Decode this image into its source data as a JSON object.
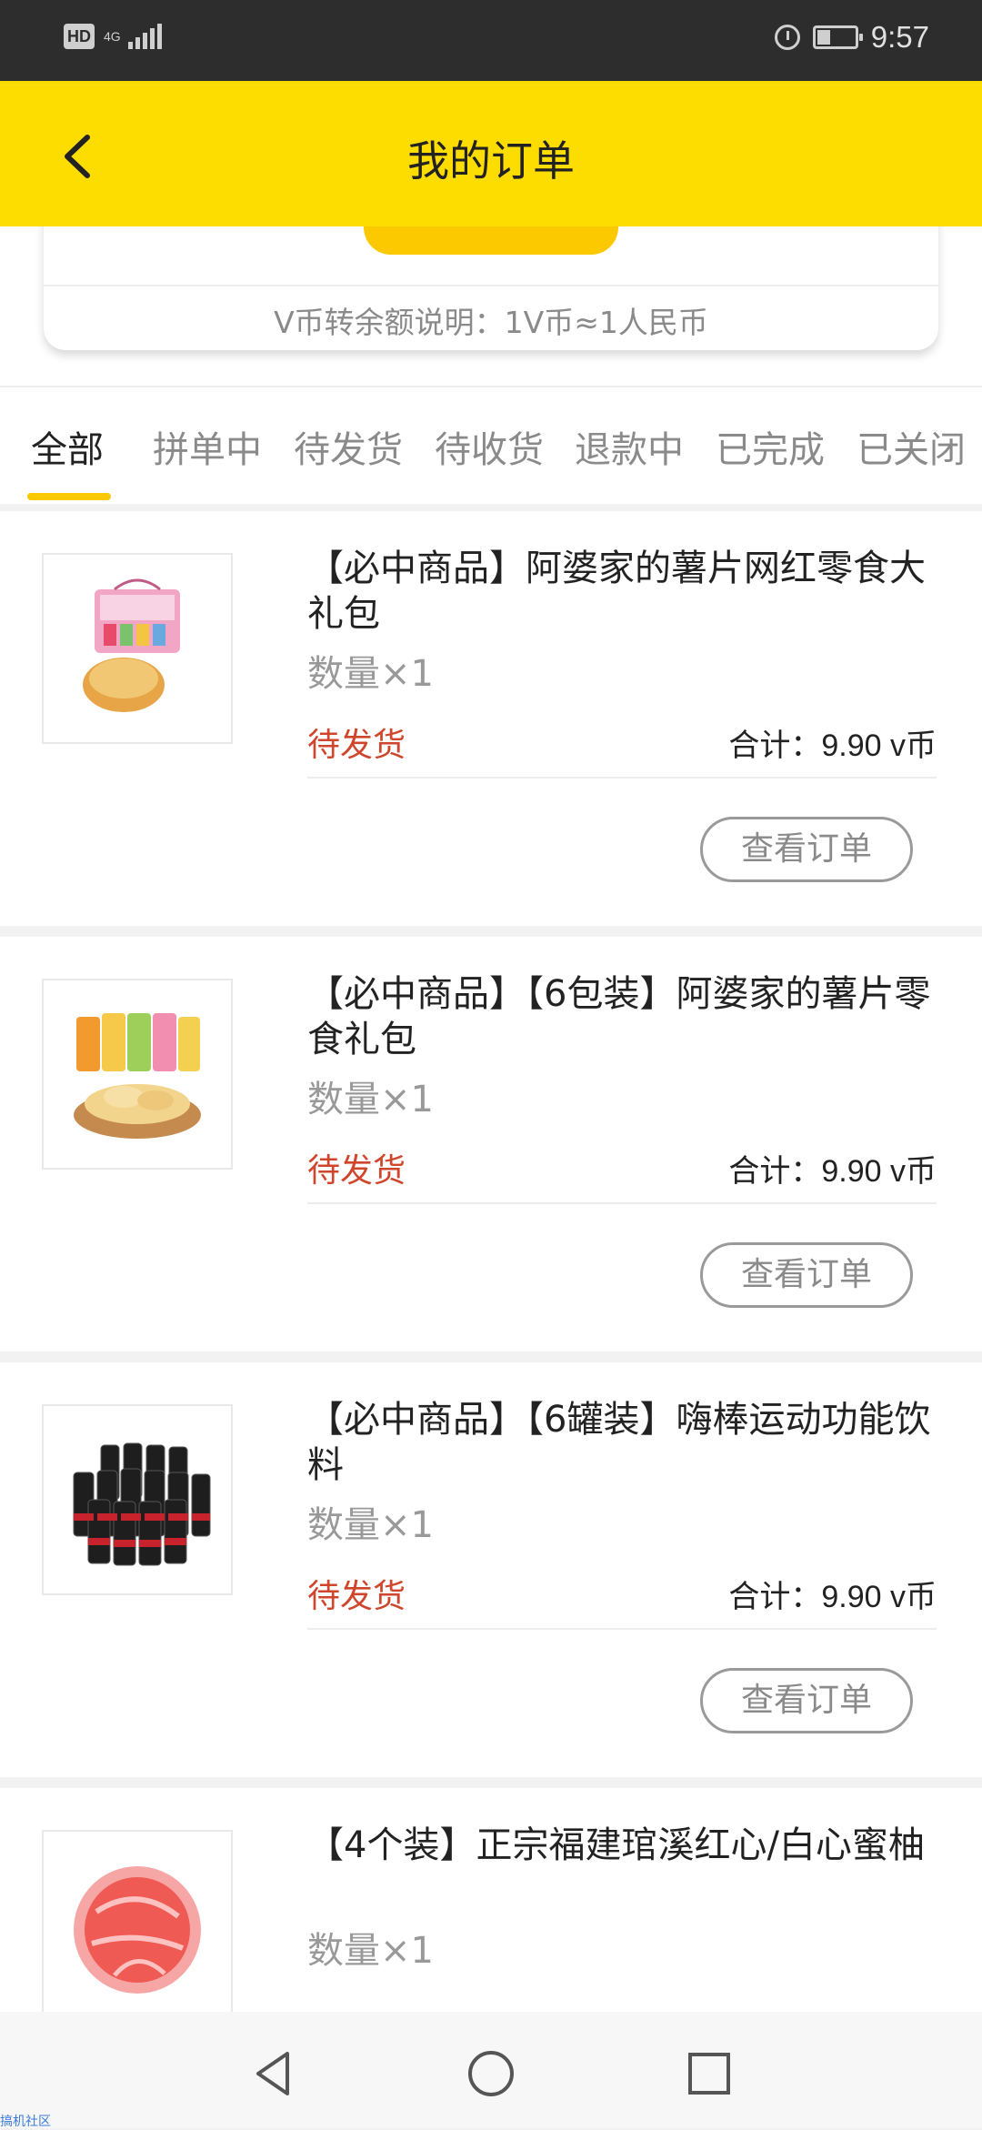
{
  "status_bar": {
    "hd": "HD",
    "network": "4G",
    "time": "9:57",
    "battery_level": 0.35
  },
  "header": {
    "title": "我的订单"
  },
  "vcoin_card": {
    "note": "V币转余额说明：1V币≈1人民币"
  },
  "tabs": [
    {
      "label": "全部"
    },
    {
      "label": "拼单中"
    },
    {
      "label": "待发货"
    },
    {
      "label": "待收货"
    },
    {
      "label": "退款中"
    },
    {
      "label": "已完成"
    },
    {
      "label": "已关闭"
    }
  ],
  "orders": [
    {
      "title": "【必中商品】阿婆家的薯片网红零食大礼包",
      "quantity": "数量×1",
      "status": "待发货",
      "total": "合计：9.90 v币",
      "button": "查看订单",
      "image": "chips-gift-box"
    },
    {
      "title": "【必中商品】【6包装】阿婆家的薯片零食礼包",
      "quantity": "数量×1",
      "status": "待发货",
      "total": "合计：9.90 v币",
      "button": "查看订单",
      "image": "chips-packs"
    },
    {
      "title": "【必中商品】【6罐装】嗨棒运动功能饮料",
      "quantity": "数量×1",
      "status": "待发货",
      "total": "合计：9.90 v币",
      "button": "查看订单",
      "image": "energy-drink-cans"
    },
    {
      "title": "【4个装】正宗福建琯溪红心/白心蜜柚",
      "quantity": "数量×1",
      "image": "red-pomelo"
    }
  ],
  "nav_bar": {
    "back_icon": "triangle-back-icon",
    "home_icon": "circle-home-icon",
    "recent_icon": "square-recent-icon"
  },
  "watermark": "搞机社区",
  "colors": {
    "header": "#fddc00",
    "accent": "#fcc800",
    "status_red": "#d0462c"
  }
}
